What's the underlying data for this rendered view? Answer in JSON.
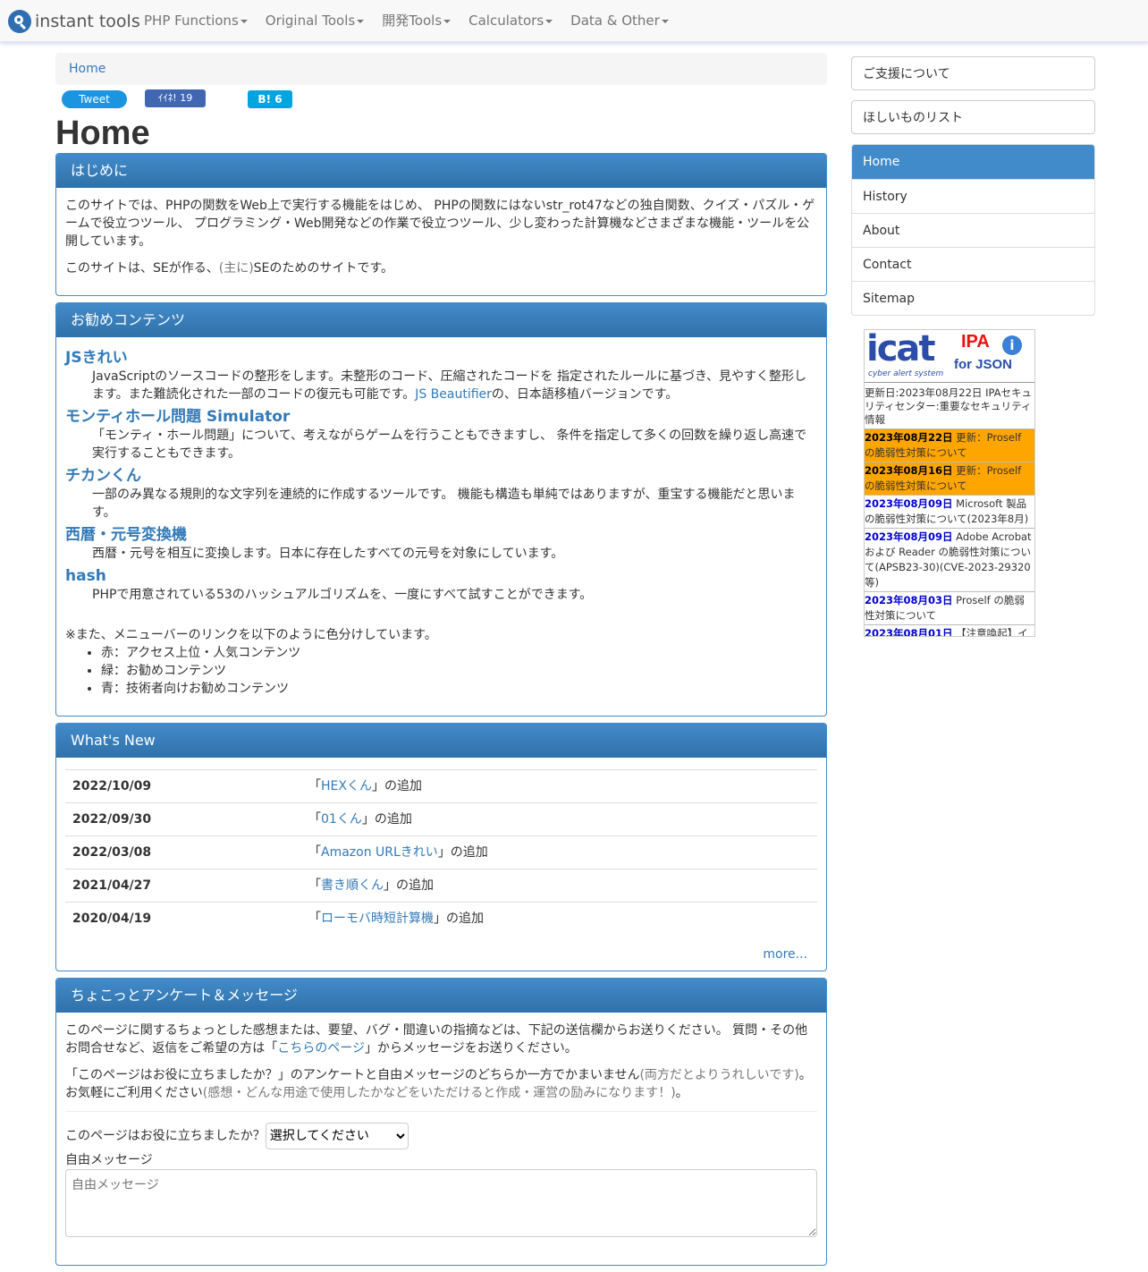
{
  "nav": {
    "brand": "instant tools",
    "items": [
      "PHP Functions",
      "Original Tools",
      "開発Tools",
      "Calculators",
      "Data & Other"
    ]
  },
  "breadcrumb": "Home",
  "share": {
    "tweet": "Tweet",
    "like": "ｲｲﾈ! 19",
    "hatena": "B! 6"
  },
  "page_title": "Home",
  "intro": {
    "heading": "はじめに",
    "p1": "このサイトでは、PHPの関数をWeb上で実行する機能をはじめ、 PHPの関数にはないstr_rot47などの独自関数、クイズ・パズル・ゲームで役立つツール、 プログラミング・Web開発などの作業で役立つツール、少し変わった計算機などさまざまな機能・ツールを公開しています。",
    "p2_a": "このサイトは、SEが作る、",
    "p2_muted": "(主に)",
    "p2_b": "SEのためのサイトです。"
  },
  "recommend": {
    "heading": "お勧めコンテンツ",
    "items": [
      {
        "title": "JSきれい",
        "desc_a": "JavaScriptのソースコードの整形をします。未整形のコード、圧縮されたコードを 指定されたルールに基づき、見やすく整形します。また難読化された一部のコードの復元も可能です。",
        "link": "JS Beautifier",
        "desc_b": "の、日本語移植バージョンです。"
      },
      {
        "title": "モンティホール問題 Simulator",
        "desc_a": "「モンティ・ホール問題」について、考えながらゲームを行うこともできますし、 条件を指定して多くの回数を繰り返し高速で実行することもできます。",
        "link": "",
        "desc_b": ""
      },
      {
        "title": "チカンくん",
        "desc_a": "一部のみ異なる規則的な文字列を連続的に作成するツールです。 機能も構造も単純ではありますが、重宝する機能だと思います。",
        "link": "",
        "desc_b": ""
      },
      {
        "title": "西暦・元号変換機",
        "desc_a": "西暦・元号を相互に変換します。日本に存在したすべての元号を対象にしています。",
        "link": "",
        "desc_b": ""
      },
      {
        "title": "hash",
        "desc_a": "PHPで用意されている53のハッシュアルゴリズムを、一度にすべて試すことができます。",
        "link": "",
        "desc_b": ""
      }
    ],
    "note": "※また、メニューバーのリンクを以下のように色分けしています。",
    "legend": [
      "赤：アクセス上位・人気コンテンツ",
      "緑：お勧めコンテンツ",
      "青：技術者向けお勧めコンテンツ"
    ]
  },
  "whats_new": {
    "heading": "What's New",
    "rows": [
      {
        "date": "2022/10/09",
        "pre": "「",
        "link": "HEXくん",
        "post": "」の追加"
      },
      {
        "date": "2022/09/30",
        "pre": "「",
        "link": "01くん",
        "post": "」の追加"
      },
      {
        "date": "2022/03/08",
        "pre": "「",
        "link": "Amazon URLきれい",
        "post": "」の追加"
      },
      {
        "date": "2021/04/27",
        "pre": "「",
        "link": "書き順くん",
        "post": "」の追加"
      },
      {
        "date": "2020/04/19",
        "pre": "「",
        "link": "ローモバ時短計算機",
        "post": "」の追加"
      }
    ],
    "more": "more..."
  },
  "survey": {
    "heading": "ちょこっとアンケート＆メッセージ",
    "p1_a": "このページに関するちょっとした感想または、要望、バグ・間違いの指摘などは、下記の送信欄からお送りください。 質問・その他お問合せなど、返信をご希望の方は「",
    "p1_link": "こちらのページ",
    "p1_b": "」からメッセージをお送りください。",
    "p2_a": "「このページはお役に立ちましたか？」のアンケートと自由メッセージのどちらか一方でかまいません",
    "p2_m1": "(両方だとよりうれしいです)",
    "p2_b": "。お気軽にご利用ください",
    "p2_m2": "(感想・どんな用途で使用したかなどをいただけると作成・運営の励みになります！)",
    "p2_c": "。",
    "question": "このページはお役に立ちましたか？",
    "select_value": "選択してください",
    "free_label": "自由メッセージ",
    "free_placeholder": "自由メッセージ"
  },
  "sidebar": {
    "buttons": [
      "ご支援について",
      "ほしいものリスト"
    ],
    "nav": [
      "Home",
      "History",
      "About",
      "Contact",
      "Sitemap"
    ],
    "active_nav": "Home"
  },
  "icat": {
    "logo_word": "icat",
    "logo_sub": "cyber alert system",
    "logo_ipa": "IPA",
    "logo_json": "for JSON",
    "updated": "更新日:2023年08月22日 IPAセキュリティセンター:重要なセキュリティ情報",
    "entries": [
      {
        "date": "2023年08月22日",
        "text": " 更新：Proself の脆弱性対策について",
        "highlight": true
      },
      {
        "date": "2023年08月16日",
        "text": " 更新：Proself の脆弱性対策について",
        "highlight": true
      },
      {
        "date": "2023年08月09日",
        "text": " Microsoft 製品の脆弱性対策について(2023年8月)",
        "highlight": false
      },
      {
        "date": "2023年08月09日",
        "text": " Adobe Acrobat および Reader の脆弱性対策について(APSB23-30)(CVE-2023-29320等)",
        "highlight": false
      },
      {
        "date": "2023年08月03日",
        "text": " Proself の脆弱性対策について",
        "highlight": false
      },
      {
        "date": "2023年08月01日",
        "text": " 【注意喚起】イ",
        "highlight": false
      }
    ]
  },
  "colors": {
    "primary": "#428bca",
    "link": "#337ab7",
    "icat_highlight": "#ffa500"
  }
}
